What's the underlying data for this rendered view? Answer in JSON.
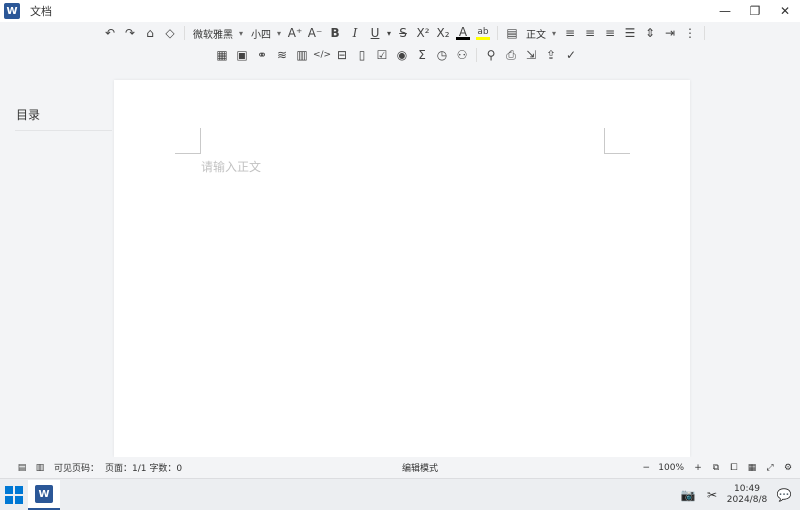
{
  "window": {
    "title": "文档",
    "app_logo": "W"
  },
  "toolbar": {
    "font_family": "微软雅黑",
    "font_size": "小四",
    "paragraph_style": "正文",
    "font_color": "#000000",
    "highlight_color": "#ffff00",
    "icons_row1": [
      "undo-icon",
      "redo-icon",
      "format-painter-icon",
      "clear-format-icon",
      "font-family-select",
      "font-size-select",
      "increase-font-icon",
      "decrease-font-icon",
      "bold-icon",
      "italic-icon",
      "underline-icon",
      "strikethrough-icon",
      "superscript-icon",
      "subscript-icon",
      "font-color-icon",
      "highlight-icon",
      "paragraph-style-select",
      "align-left-icon",
      "align-center-icon",
      "align-right-icon",
      "justify-icon",
      "line-height-icon",
      "indent-icon",
      "list-icon"
    ],
    "icons_row2": [
      "table-icon",
      "image-icon",
      "link-icon",
      "horizontal-rule-icon",
      "code-block-icon",
      "code-icon",
      "page-break-icon",
      "checklist-icon",
      "checkbox-icon",
      "radio-icon",
      "formula-icon",
      "date-icon",
      "chart-icon",
      "search-icon",
      "print-icon",
      "export-icon",
      "share-icon",
      "done-icon"
    ]
  },
  "sidebar": {
    "toc_title": "目录"
  },
  "editor": {
    "placeholder": "请输入正文"
  },
  "statusbar": {
    "visible_pages_label": "可见页码：",
    "page_info": "页面：1/1 字数：0",
    "mode": "编辑模式",
    "zoom": "100%"
  },
  "taskbar": {
    "time": "10:49",
    "date": "2024/8/8"
  },
  "colors": {
    "accent": "#2b5797"
  }
}
